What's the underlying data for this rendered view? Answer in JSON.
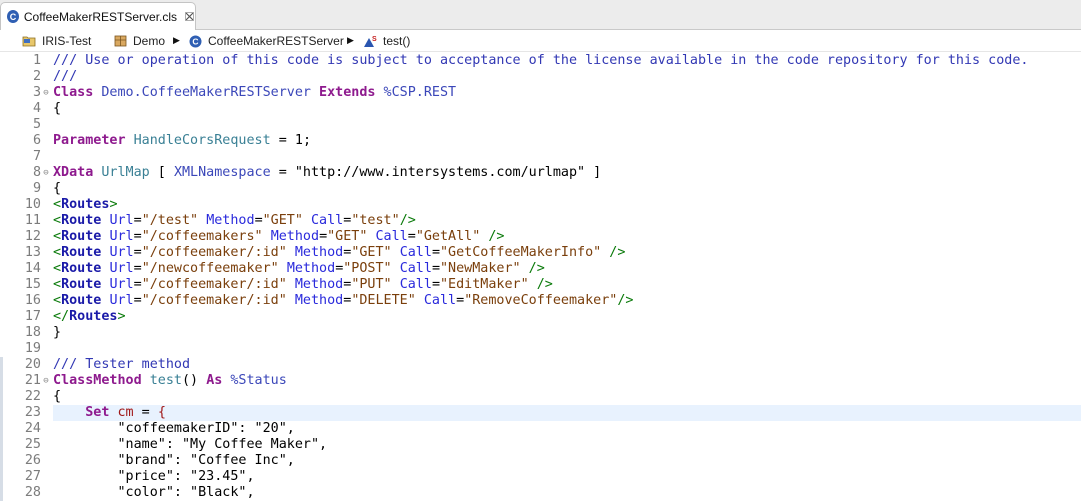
{
  "tab": {
    "label": "CoffeeMakerRESTServer.cls",
    "icon": "c-class-icon"
  },
  "breadcrumb": [
    {
      "label": "IRIS-Test",
      "icon": "project-folder-icon"
    },
    {
      "label": "Demo",
      "icon": "package-icon"
    },
    {
      "label": "CoffeeMakerRESTServer",
      "icon": "c-class-icon"
    },
    {
      "label": "test()",
      "icon": "method-icon"
    }
  ],
  "highlighted_line": 23,
  "lines": [
    {
      "n": "1",
      "fold": false,
      "tokens": [
        [
          "/// Use or operation of this code is subject to acceptance of the license available in the code repository for this code.",
          "com"
        ]
      ]
    },
    {
      "n": "2",
      "fold": false,
      "tokens": [
        [
          "///",
          "com"
        ]
      ]
    },
    {
      "n": "3",
      "fold": true,
      "tokens": [
        [
          "Class",
          "kw"
        ],
        [
          " ",
          "plain"
        ],
        [
          "Demo.CoffeeMakerRESTServer",
          "cls"
        ],
        [
          " ",
          "plain"
        ],
        [
          "Extends",
          "kw"
        ],
        [
          " ",
          "plain"
        ],
        [
          "%CSP.REST",
          "pct"
        ]
      ]
    },
    {
      "n": "4",
      "fold": false,
      "tokens": [
        [
          "{",
          "plain"
        ]
      ]
    },
    {
      "n": "5",
      "fold": false,
      "tokens": []
    },
    {
      "n": "6",
      "fold": false,
      "tokens": [
        [
          "Parameter",
          "kw"
        ],
        [
          " ",
          "plain"
        ],
        [
          "HandleCorsRequest",
          "pname"
        ],
        [
          " = ",
          "plain"
        ],
        [
          "1",
          "num"
        ],
        [
          ";",
          "plain"
        ]
      ]
    },
    {
      "n": "7",
      "fold": false,
      "tokens": []
    },
    {
      "n": "8",
      "fold": true,
      "tokens": [
        [
          "XData",
          "kw"
        ],
        [
          " ",
          "plain"
        ],
        [
          "UrlMap",
          "pname"
        ],
        [
          " [ ",
          "plain"
        ],
        [
          "XMLNamespace",
          "cls"
        ],
        [
          " = ",
          "plain"
        ],
        [
          "\"http://www.intersystems.com/urlmap\"",
          "str"
        ],
        [
          " ]",
          "plain"
        ]
      ]
    },
    {
      "n": "9",
      "fold": false,
      "tokens": [
        [
          "{",
          "plain"
        ]
      ]
    },
    {
      "n": "10",
      "fold": false,
      "tokens": [
        [
          "<",
          "brk"
        ],
        [
          "Routes",
          "tag"
        ],
        [
          ">",
          "brk"
        ]
      ]
    },
    {
      "n": "11",
      "fold": false,
      "tokens": [
        [
          "<",
          "brk"
        ],
        [
          "Route",
          "tag"
        ],
        [
          " ",
          "plain"
        ],
        [
          "Url",
          "attr"
        ],
        [
          "=",
          "plain"
        ],
        [
          "\"/test\"",
          "aval"
        ],
        [
          " ",
          "plain"
        ],
        [
          "Method",
          "attr"
        ],
        [
          "=",
          "plain"
        ],
        [
          "\"GET\"",
          "aval"
        ],
        [
          " ",
          "plain"
        ],
        [
          "Call",
          "attr"
        ],
        [
          "=",
          "plain"
        ],
        [
          "\"test\"",
          "aval"
        ],
        [
          "/>",
          "brk"
        ]
      ]
    },
    {
      "n": "12",
      "fold": false,
      "tokens": [
        [
          "<",
          "brk"
        ],
        [
          "Route",
          "tag"
        ],
        [
          " ",
          "plain"
        ],
        [
          "Url",
          "attr"
        ],
        [
          "=",
          "plain"
        ],
        [
          "\"/coffeemakers\"",
          "aval"
        ],
        [
          " ",
          "plain"
        ],
        [
          "Method",
          "attr"
        ],
        [
          "=",
          "plain"
        ],
        [
          "\"GET\"",
          "aval"
        ],
        [
          " ",
          "plain"
        ],
        [
          "Call",
          "attr"
        ],
        [
          "=",
          "plain"
        ],
        [
          "\"GetAll\"",
          "aval"
        ],
        [
          " />",
          "brk"
        ]
      ]
    },
    {
      "n": "13",
      "fold": false,
      "tokens": [
        [
          "<",
          "brk"
        ],
        [
          "Route",
          "tag"
        ],
        [
          " ",
          "plain"
        ],
        [
          "Url",
          "attr"
        ],
        [
          "=",
          "plain"
        ],
        [
          "\"/coffeemaker/:id\"",
          "aval"
        ],
        [
          " ",
          "plain"
        ],
        [
          "Method",
          "attr"
        ],
        [
          "=",
          "plain"
        ],
        [
          "\"GET\"",
          "aval"
        ],
        [
          " ",
          "plain"
        ],
        [
          "Call",
          "attr"
        ],
        [
          "=",
          "plain"
        ],
        [
          "\"GetCoffeeMakerInfo\"",
          "aval"
        ],
        [
          " />",
          "brk"
        ]
      ]
    },
    {
      "n": "14",
      "fold": false,
      "tokens": [
        [
          "<",
          "brk"
        ],
        [
          "Route",
          "tag"
        ],
        [
          " ",
          "plain"
        ],
        [
          "Url",
          "attr"
        ],
        [
          "=",
          "plain"
        ],
        [
          "\"/newcoffeemaker\"",
          "aval"
        ],
        [
          " ",
          "plain"
        ],
        [
          "Method",
          "attr"
        ],
        [
          "=",
          "plain"
        ],
        [
          "\"POST\"",
          "aval"
        ],
        [
          " ",
          "plain"
        ],
        [
          "Call",
          "attr"
        ],
        [
          "=",
          "plain"
        ],
        [
          "\"NewMaker\"",
          "aval"
        ],
        [
          " />",
          "brk"
        ]
      ]
    },
    {
      "n": "15",
      "fold": false,
      "tokens": [
        [
          "<",
          "brk"
        ],
        [
          "Route",
          "tag"
        ],
        [
          " ",
          "plain"
        ],
        [
          "Url",
          "attr"
        ],
        [
          "=",
          "plain"
        ],
        [
          "\"/coffeemaker/:id\"",
          "aval"
        ],
        [
          " ",
          "plain"
        ],
        [
          "Method",
          "attr"
        ],
        [
          "=",
          "plain"
        ],
        [
          "\"PUT\"",
          "aval"
        ],
        [
          " ",
          "plain"
        ],
        [
          "Call",
          "attr"
        ],
        [
          "=",
          "plain"
        ],
        [
          "\"EditMaker\"",
          "aval"
        ],
        [
          " />",
          "brk"
        ]
      ]
    },
    {
      "n": "16",
      "fold": false,
      "tokens": [
        [
          "<",
          "brk"
        ],
        [
          "Route",
          "tag"
        ],
        [
          " ",
          "plain"
        ],
        [
          "Url",
          "attr"
        ],
        [
          "=",
          "plain"
        ],
        [
          "\"/coffeemaker/:id\"",
          "aval"
        ],
        [
          " ",
          "plain"
        ],
        [
          "Method",
          "attr"
        ],
        [
          "=",
          "plain"
        ],
        [
          "\"DELETE\"",
          "aval"
        ],
        [
          " ",
          "plain"
        ],
        [
          "Call",
          "attr"
        ],
        [
          "=",
          "plain"
        ],
        [
          "\"RemoveCoffeemaker\"",
          "aval"
        ],
        [
          "/>",
          "brk"
        ]
      ]
    },
    {
      "n": "17",
      "fold": false,
      "tokens": [
        [
          "</",
          "brk"
        ],
        [
          "Routes",
          "tag"
        ],
        [
          ">",
          "brk"
        ]
      ]
    },
    {
      "n": "18",
      "fold": false,
      "tokens": [
        [
          "}",
          "plain"
        ]
      ]
    },
    {
      "n": "19",
      "fold": false,
      "tokens": []
    },
    {
      "n": "20",
      "fold": false,
      "tokens": [
        [
          "/// Tester method",
          "com"
        ]
      ]
    },
    {
      "n": "21",
      "fold": true,
      "tokens": [
        [
          "ClassMethod",
          "kw"
        ],
        [
          " ",
          "plain"
        ],
        [
          "test",
          "pname"
        ],
        [
          "() ",
          "plain"
        ],
        [
          "As",
          "kw"
        ],
        [
          " ",
          "plain"
        ],
        [
          "%Status",
          "pct"
        ]
      ]
    },
    {
      "n": "22",
      "fold": false,
      "tokens": [
        [
          "{",
          "plain"
        ]
      ]
    },
    {
      "n": "23",
      "fold": false,
      "tokens": [
        [
          "    ",
          "plain"
        ],
        [
          "Set",
          "kw"
        ],
        [
          " ",
          "plain"
        ],
        [
          "cm",
          "var"
        ],
        [
          " = ",
          "plain"
        ],
        [
          "{",
          "obr"
        ]
      ]
    },
    {
      "n": "24",
      "fold": false,
      "tokens": [
        [
          "        ",
          "plain"
        ],
        [
          "\"coffeemakerID\": \"20\",",
          "json"
        ]
      ]
    },
    {
      "n": "25",
      "fold": false,
      "tokens": [
        [
          "        ",
          "plain"
        ],
        [
          "\"name\": \"My Coffee Maker\",",
          "json"
        ]
      ]
    },
    {
      "n": "26",
      "fold": false,
      "tokens": [
        [
          "        ",
          "plain"
        ],
        [
          "\"brand\": \"Coffee Inc\",",
          "json"
        ]
      ]
    },
    {
      "n": "27",
      "fold": false,
      "tokens": [
        [
          "        ",
          "plain"
        ],
        [
          "\"price\": \"23.45\",",
          "json"
        ]
      ]
    },
    {
      "n": "28",
      "fold": false,
      "tokens": [
        [
          "        ",
          "plain"
        ],
        [
          "\"color\": \"Black\",",
          "json"
        ]
      ]
    }
  ]
}
